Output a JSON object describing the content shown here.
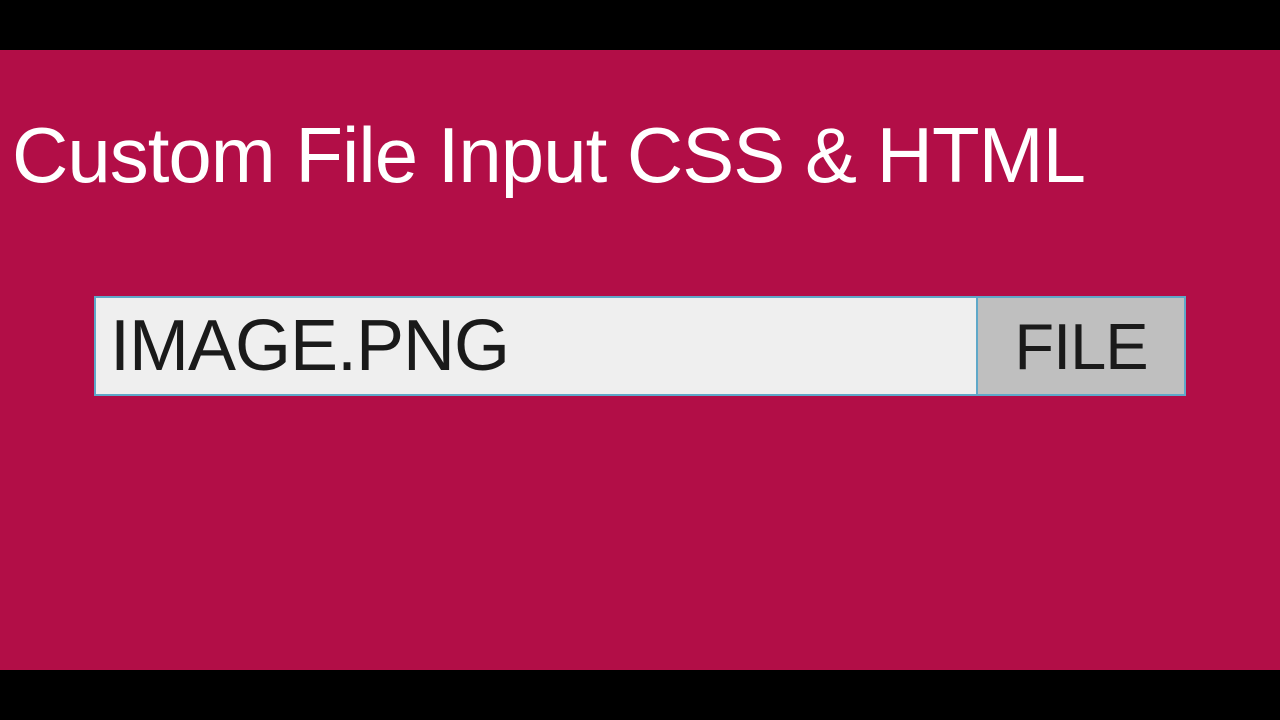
{
  "heading": "Custom File Input CSS & HTML",
  "fileInput": {
    "filename": "IMAGE.PNG",
    "buttonLabel": "FILE"
  }
}
